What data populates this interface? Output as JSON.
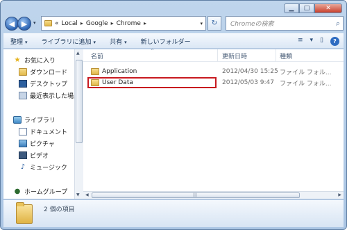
{
  "window": {
    "minimize": "▁",
    "maximize": "□",
    "close": "✕"
  },
  "nav": {
    "back": "◀",
    "forward": "▶",
    "dropdown": "▾"
  },
  "address": {
    "prefix": "«",
    "crumbs": [
      "Local",
      "Google",
      "Chrome"
    ],
    "separator": "▸",
    "dropdown": "▾"
  },
  "refresh": "↻",
  "search": {
    "placeholder": "Chromeの検索",
    "icon": "⌕"
  },
  "toolbar": {
    "organize": "整理",
    "add_to_library": "ライブラリに追加",
    "share": "共有",
    "new_folder": "新しいフォルダー",
    "dropdown": "▾",
    "view_icon": "≡",
    "pane_icon": "▯",
    "help": "?"
  },
  "sidebar": {
    "favorites": "お気に入り",
    "downloads": "ダウンロード",
    "desktop": "デスクトップ",
    "recent": "最近表示した場所",
    "libraries": "ライブラリ",
    "documents": "ドキュメント",
    "pictures": "ピクチャ",
    "videos": "ビデオ",
    "music": "ミュージック",
    "homegroup": "ホームグループ"
  },
  "columns": {
    "name": "名前",
    "date": "更新日時",
    "type": "種類",
    "sort_caret": "^"
  },
  "files": [
    {
      "name": "Application",
      "date": "2012/04/30 15:25",
      "type": "ファイル フォル..."
    },
    {
      "name": "User Data",
      "date": "2012/05/03 9:47",
      "type": "ファイル フォル..."
    }
  ],
  "scroll": {
    "up": "▲",
    "down": "▼",
    "left": "◀",
    "right": "▶",
    "grip": "|||"
  },
  "status": {
    "count": "2 個の項目"
  }
}
